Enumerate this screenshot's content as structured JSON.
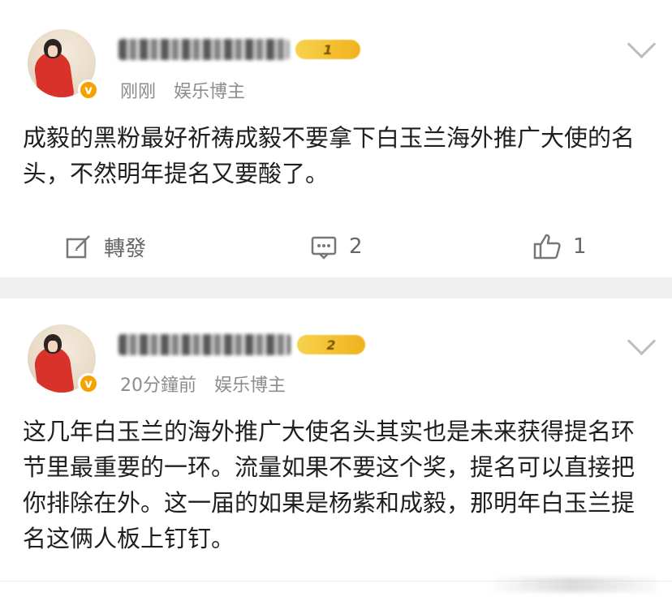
{
  "posts": [
    {
      "time": "刚刚",
      "tag": "娱乐博主",
      "level": "1",
      "text": "成毅的黑粉最好祈祷成毅不要拿下白玉兰海外推广大使的名头，不然明年提名又要酸了。",
      "actions": {
        "repost_label": "轉發",
        "comment_count": "2",
        "like_count": "1"
      }
    },
    {
      "time": "20分鐘前",
      "tag": "娱乐博主",
      "level": "2",
      "text": "这几年白玉兰的海外推广大使名头其实也是未来获得提名环节里最重要的一环。流量如果不要这个奖，提名可以直接把你排除在外。这一届的如果是杨紫和成毅，那明年白玉兰提名这俩人板上钉钉。"
    }
  ],
  "colors": {
    "separator": "#efefef",
    "badge": "#f5a200",
    "meta": "#8c8c8c"
  },
  "icons": {
    "repost": "pencil-square-icon",
    "comment": "comment-icon",
    "like": "thumbs-up-icon",
    "more": "chevron-down-icon",
    "verified": "verified-v-icon"
  }
}
